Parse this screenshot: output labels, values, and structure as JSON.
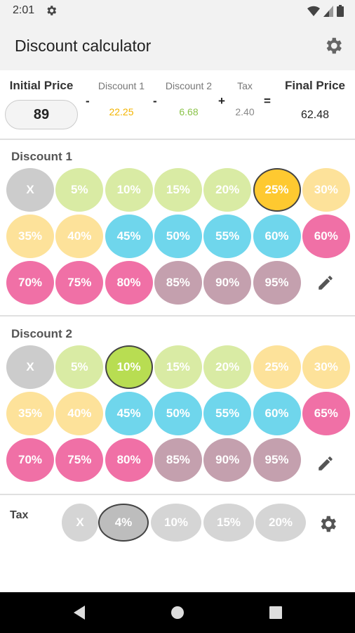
{
  "status": {
    "time": "2:01",
    "icons": [
      "gear-icon",
      "wifi-icon",
      "signal-icon",
      "battery-icon"
    ]
  },
  "app_bar": {
    "title": "Discount calculator",
    "action_icon": "gear-icon"
  },
  "summary": {
    "initial_label": "Initial Price",
    "initial_value": "89",
    "op1": "-",
    "discount1_label": "Discount 1",
    "discount1_value": "22.25",
    "op2": "-",
    "discount2_label": "Discount 2",
    "discount2_value": "6.68",
    "op3": "+",
    "tax_label": "Tax",
    "tax_value": "2.40",
    "op4": "=",
    "final_label": "Final Price",
    "final_value": "62.48"
  },
  "colors": {
    "gray": "#cccccc",
    "green_light": "#d9eba4",
    "green_selected": "#b8dd52",
    "yellow_light": "#fde29a",
    "yellow_selected": "#fec930",
    "blue": "#6fd6ec",
    "pink": "#f070a6",
    "mauve": "#c4a0ae",
    "discount1_text": "#f3b400",
    "discount2_text": "#8bc34a"
  },
  "discount1": {
    "title": "Discount 1",
    "options": [
      "X",
      "5%",
      "10%",
      "15%",
      "20%",
      "25%",
      "30%",
      "35%",
      "40%",
      "45%",
      "50%",
      "55%",
      "60%",
      "60%",
      "70%",
      "75%",
      "80%",
      "85%",
      "90%",
      "95%"
    ],
    "selected": "25%",
    "edit_icon": "pencil-icon"
  },
  "discount2": {
    "title": "Discount 2",
    "options": [
      "X",
      "5%",
      "10%",
      "15%",
      "20%",
      "25%",
      "30%",
      "35%",
      "40%",
      "45%",
      "50%",
      "55%",
      "60%",
      "65%",
      "70%",
      "75%",
      "80%",
      "85%",
      "90%",
      "95%"
    ],
    "selected": "10%",
    "edit_icon": "pencil-icon"
  },
  "tax": {
    "title": "Tax",
    "options": [
      "X",
      "4%",
      "10%",
      "15%",
      "20%"
    ],
    "selected": "4%",
    "settings_icon": "gear-icon"
  },
  "nav": {
    "icons": [
      "back-icon",
      "home-icon",
      "recents-icon"
    ]
  }
}
